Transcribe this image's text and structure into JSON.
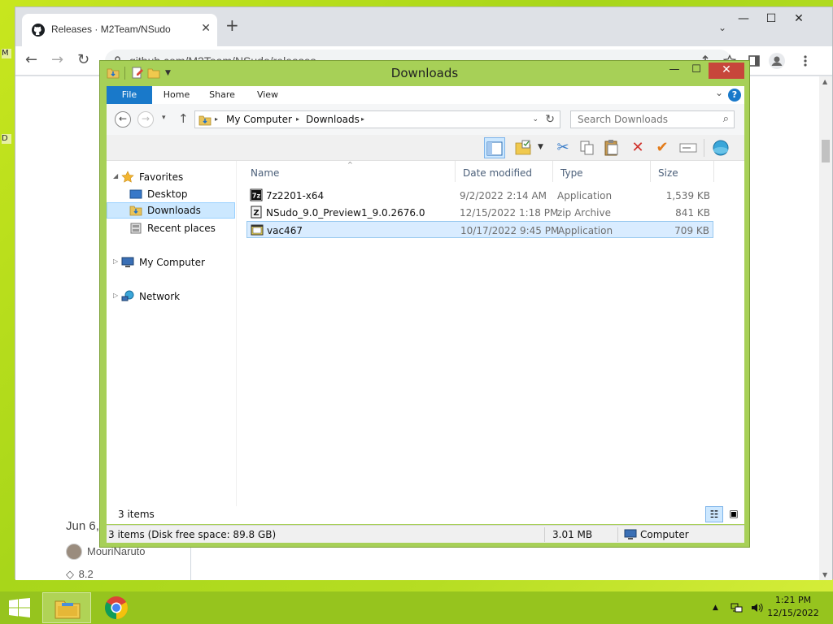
{
  "browser": {
    "tab_title": "Releases · M2Team/NSudo",
    "tab_close": "✕",
    "new_tab": "+",
    "tab_menu": "⌄",
    "url": "github.com/M2Team/NSudo/releases",
    "min": "—",
    "max": "☐",
    "close": "✕",
    "back": "←",
    "forward": "→",
    "reload": "↻",
    "page": {
      "release_date": "Jun 6,",
      "author": "MouriNaruto",
      "tag": "8.2"
    }
  },
  "desktop": {
    "mark_top": "M",
    "mark_mid": "D"
  },
  "explorer": {
    "title": "Downloads",
    "buttons": {
      "min": "—",
      "max": "☐",
      "close": "✕",
      "help": "?",
      "expand": "⌄"
    },
    "ribbon_tabs": [
      "File",
      "Home",
      "Share",
      "View"
    ],
    "nav": {
      "back": "←",
      "forward": "→",
      "recent": "▾",
      "up": "↑"
    },
    "address": {
      "crumbs": [
        "My Computer",
        "Downloads"
      ],
      "sep": "▸",
      "dropdown": "⌄",
      "refresh": "↻"
    },
    "search": {
      "placeholder": "Search Downloads",
      "icon": "⌕"
    },
    "toolbar_icons": [
      "preview-pane-icon",
      "properties-icon",
      "cut-icon",
      "copy-icon",
      "paste-icon",
      "delete-icon",
      "checkmark-icon",
      "rename-icon",
      "network-shell-icon"
    ],
    "navpane": {
      "favorites": "Favorites",
      "desktop": "Desktop",
      "downloads": "Downloads",
      "recent": "Recent places",
      "computer": "My Computer",
      "network": "Network",
      "collapse": "◢",
      "expand": "▷"
    },
    "columns": {
      "name": "Name",
      "date": "Date modified",
      "type": "Type",
      "size": "Size",
      "sort": "^"
    },
    "files": [
      {
        "name": "7z2201-x64",
        "date": "9/2/2022 2:14 AM",
        "type": "Application",
        "size": "1,539 KB"
      },
      {
        "name": "NSudo_9.0_Preview1_9.0.2676.0",
        "date": "12/15/2022 1:18 PM",
        "type": "zip Archive",
        "size": "841 KB"
      },
      {
        "name": "vac467",
        "date": "10/17/2022 9:45 PM",
        "type": "Application",
        "size": "709 KB"
      }
    ],
    "item_count": "3 items",
    "status": {
      "summary": "3 items (Disk free space: 89.8 GB)",
      "size": "3.01 MB",
      "location": "Computer"
    }
  },
  "taskbar": {
    "tray_up": "▲",
    "time": "1:21 PM",
    "date": "12/15/2022"
  }
}
